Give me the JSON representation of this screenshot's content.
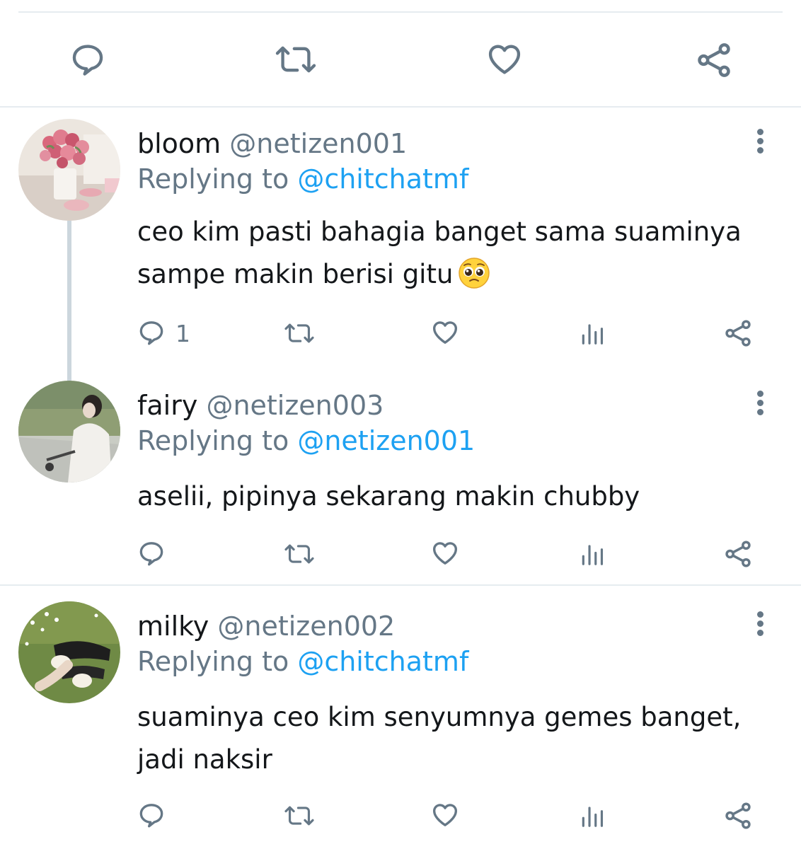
{
  "colors": {
    "text": "#14171a",
    "secondary": "#657786",
    "accent": "#1da1f2",
    "divider": "#e6ecf0"
  },
  "top_action_bar": {
    "icons": [
      "reply-icon",
      "retweet-icon",
      "like-icon",
      "share-icon"
    ]
  },
  "replies": [
    {
      "name": "bloom",
      "handle": "@netizen001",
      "replying_prefix": "Replying to",
      "replying_to": "@chitchatmf",
      "text": "ceo kim pasti bahagia banget sama suaminya sampe makin berisi gitu",
      "emoji": "pleading-face",
      "reply_count": "1"
    },
    {
      "name": "fairy",
      "handle": "@netizen003",
      "replying_prefix": "Replying to",
      "replying_to": "@netizen001",
      "text": "aselii, pipinya sekarang makin chubby",
      "reply_count": ""
    },
    {
      "name": "milky",
      "handle": "@netizen002",
      "replying_prefix": "Replying to",
      "replying_to": "@chitchatmf",
      "text": "suaminya ceo kim senyumnya gemes banget, jadi naksir",
      "reply_count": ""
    }
  ]
}
